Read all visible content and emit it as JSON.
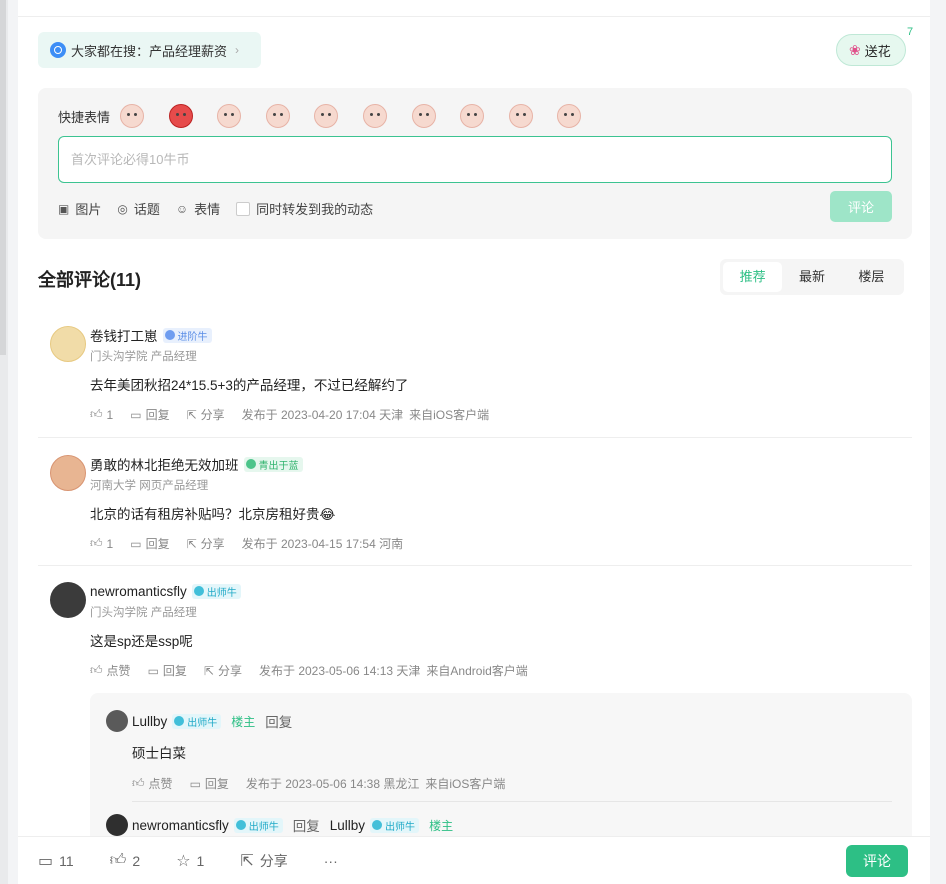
{
  "hot_search": {
    "prefix": "大家都在搜：",
    "keyword": "产品经理薪资"
  },
  "flower": {
    "label": "送花",
    "count": "7"
  },
  "composer": {
    "quick_emoji_label": "快捷表情",
    "placeholder": "首次评论必得10牛币",
    "tools": {
      "image": "图片",
      "topic": "话题",
      "emoji": "表情",
      "repost": "同时转发到我的动态"
    },
    "submit_label": "评论"
  },
  "comments_header": {
    "title": "全部评论(11)",
    "tabs": [
      "推荐",
      "最新",
      "楼层"
    ],
    "active_tab": "推荐"
  },
  "comments": [
    {
      "name": "卷钱打工崽",
      "badge": "进阶牛",
      "sub": "门头沟学院 产品经理",
      "text": "去年美团秋招24*15.5+3的产品经理，不过已经解约了",
      "like": "1",
      "reply": "回复",
      "share": "分享",
      "time": "发布于 2023-04-20 17:04 天津",
      "client": "来自iOS客户端"
    },
    {
      "name": "勇敢的林北拒绝无效加班",
      "badge": "青出于蓝",
      "sub": "河南大学 网页产品经理",
      "text": "北京的话有租房补贴吗？北京房租好贵😂",
      "like": "1",
      "reply": "回复",
      "share": "分享",
      "time": "发布于 2023-04-15 17:54 河南",
      "client": ""
    },
    {
      "name": "newromanticsfly",
      "badge": "出师牛",
      "sub": "门头沟学院 产品经理",
      "text": "这是sp还是ssp呢",
      "like": "点赞",
      "reply": "回复",
      "share": "分享",
      "time": "发布于 2023-05-06 14:13 天津",
      "client": "来自Android客户端"
    }
  ],
  "replies": [
    {
      "name": "Lullby",
      "badge": "出师牛",
      "host": "楼主",
      "reply": "回复",
      "text": "硕士白菜",
      "like": "点赞",
      "reply2": "回复",
      "time": "发布于 2023-05-06 14:38 黑龙江",
      "client": "来自iOS客户端"
    },
    {
      "name": "newromanticsfly",
      "badge": "出师牛",
      "reply_word": "回复",
      "target": "Lullby",
      "target_badge": "出师牛",
      "host": "楼主"
    }
  ],
  "bottom_bar": {
    "comments": "11",
    "likes": "2",
    "stars": "1",
    "share": "分享",
    "more": "···",
    "submit": "评论"
  },
  "colors": {
    "accent": "#2dbf85",
    "accent_light": "#9ee5c8",
    "badge_blue": "#5b8ee6"
  }
}
